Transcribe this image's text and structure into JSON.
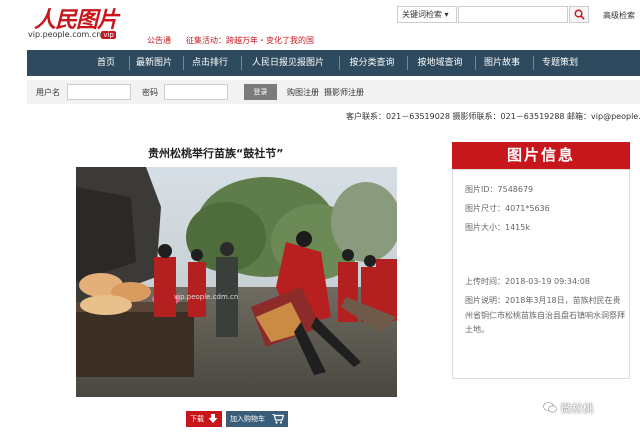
{
  "header": {
    "logo_text": "人民图片",
    "logo_sub": "图片",
    "logo_url": "vip.people.com.cn",
    "logo_vip": "vip",
    "notice_label": "公告通",
    "notice_text": "征集活动：跨越万年・变化了我的国",
    "search_select": "关键词检索",
    "advanced_search": "高级检索"
  },
  "nav": {
    "items": [
      "首页",
      "最新图片",
      "点击排行",
      "人民日报见报图片",
      "按分类查询",
      "按地域查询",
      "图片故事",
      "专题策划"
    ]
  },
  "login": {
    "username_label": "用户名",
    "password_label": "密码",
    "login_button": "登录",
    "buyer_register": "购图注册",
    "photographer_register": "摄影师注册"
  },
  "contact": {
    "text": "客户联系：021－63519028   摄影师联系：021－63519288   邮箱：vip@people.cn"
  },
  "photo": {
    "title": "贵州松桃举行苗族“鼓社节”",
    "watermark": "vip.people.cdm.cn"
  },
  "actions": {
    "download": "下载",
    "add_to_cart": "加入购物车"
  },
  "info": {
    "heading": "图片信息",
    "id": "图片ID：7548679",
    "size": "图片尺寸：4071*5636",
    "filesize": "图片大小：1415k",
    "upload_time": "上传时间：2018-03-19 09:34:08",
    "description": "图片说明：2018年3月18日，苗族村民在贵州省铜仁市松桃苗族自治县盘石镇响水洞祭拜土地。"
  },
  "footer_badge": "微松桃",
  "colors": {
    "brand_red": "#c8161d",
    "nav_blue": "#2d4a5e"
  }
}
